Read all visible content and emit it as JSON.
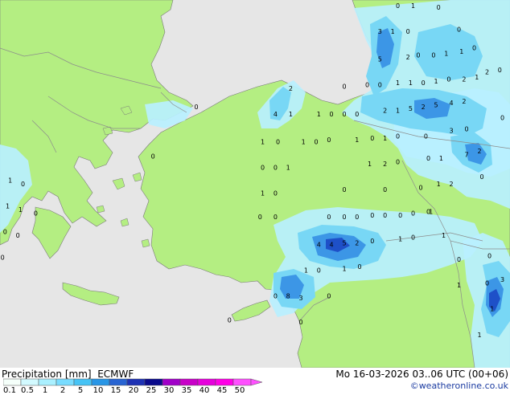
{
  "title": "Precipitation [mm]",
  "model": "ECMWF",
  "valid_time": "Mo 16-03-2026 03..06 UTC (00+06)",
  "credit": "©weatheronline.co.uk",
  "colors": {
    "sea": "#e6e6e6",
    "land": "#b4ee82",
    "border": "#8c8c8c",
    "coast": "#7a7a7a",
    "precip_light": "#b9f0ff",
    "precip_medium": "#78d7f5",
    "precip_heavy": "#3c96e6",
    "precip_very_heavy": "#1e50c8"
  },
  "legend": {
    "labels": [
      "0.1",
      "0.5",
      "1",
      "2",
      "5",
      "10",
      "15",
      "20",
      "25",
      "30",
      "35",
      "40",
      "45",
      "50"
    ],
    "colors": [
      "#f5fffa",
      "#d2faff",
      "#aaf0ff",
      "#78dcff",
      "#46c3f5",
      "#2896e6",
      "#2864d2",
      "#1e32b4",
      "#0a0a8c",
      "#a000c8",
      "#c800c8",
      "#e600dc",
      "#ff00e6",
      "#ff50ff"
    ]
  },
  "grid_values": [
    {
      "v": "0",
      "lon": 0.78,
      "lat": 0.015
    },
    {
      "v": "1",
      "lon": 0.81,
      "lat": 0.015
    },
    {
      "v": "0",
      "lon": 0.86,
      "lat": 0.02
    },
    {
      "v": "3",
      "lon": 0.745,
      "lat": 0.085
    },
    {
      "v": "1",
      "lon": 0.77,
      "lat": 0.085
    },
    {
      "v": "0",
      "lon": 0.8,
      "lat": 0.085
    },
    {
      "v": "0",
      "lon": 0.9,
      "lat": 0.08
    },
    {
      "v": "5",
      "lon": 0.745,
      "lat": 0.16
    },
    {
      "v": "2",
      "lon": 0.8,
      "lat": 0.155
    },
    {
      "v": "0",
      "lon": 0.82,
      "lat": 0.15
    },
    {
      "v": "0",
      "lon": 0.85,
      "lat": 0.15
    },
    {
      "v": "1",
      "lon": 0.875,
      "lat": 0.145
    },
    {
      "v": "1",
      "lon": 0.905,
      "lat": 0.14
    },
    {
      "v": "0",
      "lon": 0.93,
      "lat": 0.13
    },
    {
      "v": "2",
      "lon": 0.955,
      "lat": 0.195
    },
    {
      "v": "0",
      "lon": 0.98,
      "lat": 0.19
    },
    {
      "v": "2",
      "lon": 0.57,
      "lat": 0.24
    },
    {
      "v": "0",
      "lon": 0.675,
      "lat": 0.235
    },
    {
      "v": "0",
      "lon": 0.72,
      "lat": 0.23
    },
    {
      "v": "0",
      "lon": 0.745,
      "lat": 0.23
    },
    {
      "v": "1",
      "lon": 0.78,
      "lat": 0.225
    },
    {
      "v": "1",
      "lon": 0.805,
      "lat": 0.225
    },
    {
      "v": "0",
      "lon": 0.83,
      "lat": 0.225
    },
    {
      "v": "1",
      "lon": 0.855,
      "lat": 0.22
    },
    {
      "v": "0",
      "lon": 0.88,
      "lat": 0.215
    },
    {
      "v": "2",
      "lon": 0.91,
      "lat": 0.215
    },
    {
      "v": "1",
      "lon": 0.935,
      "lat": 0.21
    },
    {
      "v": "0",
      "lon": 0.385,
      "lat": 0.29
    },
    {
      "v": "4",
      "lon": 0.54,
      "lat": 0.31
    },
    {
      "v": "1",
      "lon": 0.57,
      "lat": 0.31
    },
    {
      "v": "1",
      "lon": 0.625,
      "lat": 0.31
    },
    {
      "v": "0",
      "lon": 0.65,
      "lat": 0.31
    },
    {
      "v": "0",
      "lon": 0.675,
      "lat": 0.31
    },
    {
      "v": "0",
      "lon": 0.7,
      "lat": 0.31
    },
    {
      "v": "2",
      "lon": 0.755,
      "lat": 0.3
    },
    {
      "v": "1",
      "lon": 0.78,
      "lat": 0.3
    },
    {
      "v": "5",
      "lon": 0.805,
      "lat": 0.295
    },
    {
      "v": "2",
      "lon": 0.83,
      "lat": 0.29
    },
    {
      "v": "5",
      "lon": 0.855,
      "lat": 0.285
    },
    {
      "v": "4",
      "lon": 0.885,
      "lat": 0.28
    },
    {
      "v": "2",
      "lon": 0.91,
      "lat": 0.275
    },
    {
      "v": "0",
      "lon": 0.985,
      "lat": 0.32
    },
    {
      "v": "1",
      "lon": 0.515,
      "lat": 0.385
    },
    {
      "v": "0",
      "lon": 0.545,
      "lat": 0.385
    },
    {
      "v": "1",
      "lon": 0.595,
      "lat": 0.385
    },
    {
      "v": "0",
      "lon": 0.62,
      "lat": 0.385
    },
    {
      "v": "0",
      "lon": 0.645,
      "lat": 0.38
    },
    {
      "v": "1",
      "lon": 0.7,
      "lat": 0.38
    },
    {
      "v": "0",
      "lon": 0.73,
      "lat": 0.375
    },
    {
      "v": "1",
      "lon": 0.755,
      "lat": 0.375
    },
    {
      "v": "0",
      "lon": 0.78,
      "lat": 0.37
    },
    {
      "v": "0",
      "lon": 0.835,
      "lat": 0.37
    },
    {
      "v": "3",
      "lon": 0.885,
      "lat": 0.355
    },
    {
      "v": "0",
      "lon": 0.915,
      "lat": 0.35
    },
    {
      "v": "0",
      "lon": 0.3,
      "lat": 0.425
    },
    {
      "v": "0",
      "lon": 0.515,
      "lat": 0.455
    },
    {
      "v": "0",
      "lon": 0.54,
      "lat": 0.455
    },
    {
      "v": "1",
      "lon": 0.565,
      "lat": 0.455
    },
    {
      "v": "1",
      "lon": 0.725,
      "lat": 0.445
    },
    {
      "v": "2",
      "lon": 0.755,
      "lat": 0.445
    },
    {
      "v": "0",
      "lon": 0.78,
      "lat": 0.44
    },
    {
      "v": "0",
      "lon": 0.84,
      "lat": 0.43
    },
    {
      "v": "1",
      "lon": 0.865,
      "lat": 0.43
    },
    {
      "v": "7",
      "lon": 0.915,
      "lat": 0.42
    },
    {
      "v": "2",
      "lon": 0.94,
      "lat": 0.41
    },
    {
      "v": "1",
      "lon": 0.02,
      "lat": 0.49
    },
    {
      "v": "0",
      "lon": 0.045,
      "lat": 0.5
    },
    {
      "v": "1",
      "lon": 0.515,
      "lat": 0.525
    },
    {
      "v": "0",
      "lon": 0.54,
      "lat": 0.525
    },
    {
      "v": "0",
      "lon": 0.675,
      "lat": 0.515
    },
    {
      "v": "0",
      "lon": 0.755,
      "lat": 0.515
    },
    {
      "v": "0",
      "lon": 0.825,
      "lat": 0.51
    },
    {
      "v": "1",
      "lon": 0.86,
      "lat": 0.5
    },
    {
      "v": "2",
      "lon": 0.885,
      "lat": 0.5
    },
    {
      "v": "0",
      "lon": 0.945,
      "lat": 0.48
    },
    {
      "v": "1",
      "lon": 0.015,
      "lat": 0.56
    },
    {
      "v": "1",
      "lon": 0.04,
      "lat": 0.57
    },
    {
      "v": "0",
      "lon": 0.07,
      "lat": 0.58
    },
    {
      "v": "0",
      "lon": 0.51,
      "lat": 0.59
    },
    {
      "v": "0",
      "lon": 0.54,
      "lat": 0.59
    },
    {
      "v": "0",
      "lon": 0.645,
      "lat": 0.59
    },
    {
      "v": "0",
      "lon": 0.675,
      "lat": 0.59
    },
    {
      "v": "0",
      "lon": 0.7,
      "lat": 0.59
    },
    {
      "v": "0",
      "lon": 0.73,
      "lat": 0.585
    },
    {
      "v": "0",
      "lon": 0.755,
      "lat": 0.585
    },
    {
      "v": "0",
      "lon": 0.785,
      "lat": 0.585
    },
    {
      "v": "0",
      "lon": 0.81,
      "lat": 0.58
    },
    {
      "v": "0",
      "lon": 0.84,
      "lat": 0.575
    },
    {
      "v": "1",
      "lon": 0.845,
      "lat": 0.575
    },
    {
      "v": "0",
      "lon": 0.01,
      "lat": 0.63
    },
    {
      "v": "0",
      "lon": 0.035,
      "lat": 0.64
    },
    {
      "v": "4",
      "lon": 0.625,
      "lat": 0.665
    },
    {
      "v": "4",
      "lon": 0.65,
      "lat": 0.665
    },
    {
      "v": "5",
      "lon": 0.675,
      "lat": 0.66
    },
    {
      "v": "2",
      "lon": 0.7,
      "lat": 0.66
    },
    {
      "v": "0",
      "lon": 0.73,
      "lat": 0.655
    },
    {
      "v": "1",
      "lon": 0.785,
      "lat": 0.65
    },
    {
      "v": "0",
      "lon": 0.81,
      "lat": 0.645
    },
    {
      "v": "1",
      "lon": 0.87,
      "lat": 0.64
    },
    {
      "v": "0",
      "lon": 0.005,
      "lat": 0.7
    },
    {
      "v": "1",
      "lon": 0.6,
      "lat": 0.735
    },
    {
      "v": "0",
      "lon": 0.625,
      "lat": 0.735
    },
    {
      "v": "1",
      "lon": 0.675,
      "lat": 0.73
    },
    {
      "v": "0",
      "lon": 0.705,
      "lat": 0.725
    },
    {
      "v": "0",
      "lon": 0.9,
      "lat": 0.705
    },
    {
      "v": "0",
      "lon": 0.96,
      "lat": 0.695
    },
    {
      "v": "1",
      "lon": 0.9,
      "lat": 0.775
    },
    {
      "v": "0",
      "lon": 0.955,
      "lat": 0.77
    },
    {
      "v": "3",
      "lon": 0.985,
      "lat": 0.76
    },
    {
      "v": "0",
      "lon": 0.54,
      "lat": 0.805
    },
    {
      "v": "8",
      "lon": 0.565,
      "lat": 0.805
    },
    {
      "v": "3",
      "lon": 0.59,
      "lat": 0.81
    },
    {
      "v": "0",
      "lon": 0.645,
      "lat": 0.805
    },
    {
      "v": "1",
      "lon": 0.965,
      "lat": 0.84
    },
    {
      "v": "0",
      "lon": 0.45,
      "lat": 0.87
    },
    {
      "v": "0",
      "lon": 0.59,
      "lat": 0.875
    },
    {
      "v": "1",
      "lon": 0.94,
      "lat": 0.91
    }
  ]
}
